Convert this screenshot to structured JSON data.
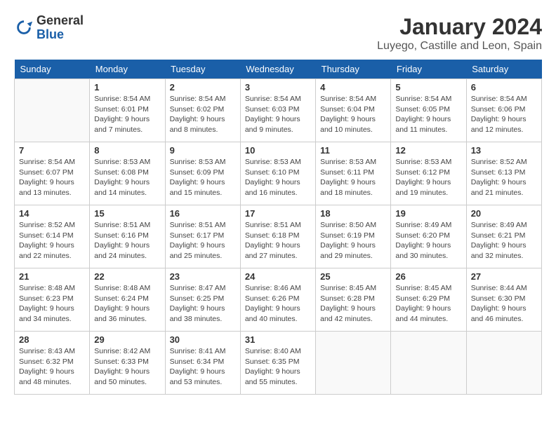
{
  "header": {
    "logo_general": "General",
    "logo_blue": "Blue",
    "title": "January 2024",
    "subtitle": "Luyego, Castille and Leon, Spain"
  },
  "days_of_week": [
    "Sunday",
    "Monday",
    "Tuesday",
    "Wednesday",
    "Thursday",
    "Friday",
    "Saturday"
  ],
  "weeks": [
    [
      {
        "day": "",
        "info": ""
      },
      {
        "day": "1",
        "info": "Sunrise: 8:54 AM\nSunset: 6:01 PM\nDaylight: 9 hours\nand 7 minutes."
      },
      {
        "day": "2",
        "info": "Sunrise: 8:54 AM\nSunset: 6:02 PM\nDaylight: 9 hours\nand 8 minutes."
      },
      {
        "day": "3",
        "info": "Sunrise: 8:54 AM\nSunset: 6:03 PM\nDaylight: 9 hours\nand 9 minutes."
      },
      {
        "day": "4",
        "info": "Sunrise: 8:54 AM\nSunset: 6:04 PM\nDaylight: 9 hours\nand 10 minutes."
      },
      {
        "day": "5",
        "info": "Sunrise: 8:54 AM\nSunset: 6:05 PM\nDaylight: 9 hours\nand 11 minutes."
      },
      {
        "day": "6",
        "info": "Sunrise: 8:54 AM\nSunset: 6:06 PM\nDaylight: 9 hours\nand 12 minutes."
      }
    ],
    [
      {
        "day": "7",
        "info": "Sunrise: 8:54 AM\nSunset: 6:07 PM\nDaylight: 9 hours\nand 13 minutes."
      },
      {
        "day": "8",
        "info": "Sunrise: 8:53 AM\nSunset: 6:08 PM\nDaylight: 9 hours\nand 14 minutes."
      },
      {
        "day": "9",
        "info": "Sunrise: 8:53 AM\nSunset: 6:09 PM\nDaylight: 9 hours\nand 15 minutes."
      },
      {
        "day": "10",
        "info": "Sunrise: 8:53 AM\nSunset: 6:10 PM\nDaylight: 9 hours\nand 16 minutes."
      },
      {
        "day": "11",
        "info": "Sunrise: 8:53 AM\nSunset: 6:11 PM\nDaylight: 9 hours\nand 18 minutes."
      },
      {
        "day": "12",
        "info": "Sunrise: 8:53 AM\nSunset: 6:12 PM\nDaylight: 9 hours\nand 19 minutes."
      },
      {
        "day": "13",
        "info": "Sunrise: 8:52 AM\nSunset: 6:13 PM\nDaylight: 9 hours\nand 21 minutes."
      }
    ],
    [
      {
        "day": "14",
        "info": "Sunrise: 8:52 AM\nSunset: 6:14 PM\nDaylight: 9 hours\nand 22 minutes."
      },
      {
        "day": "15",
        "info": "Sunrise: 8:51 AM\nSunset: 6:16 PM\nDaylight: 9 hours\nand 24 minutes."
      },
      {
        "day": "16",
        "info": "Sunrise: 8:51 AM\nSunset: 6:17 PM\nDaylight: 9 hours\nand 25 minutes."
      },
      {
        "day": "17",
        "info": "Sunrise: 8:51 AM\nSunset: 6:18 PM\nDaylight: 9 hours\nand 27 minutes."
      },
      {
        "day": "18",
        "info": "Sunrise: 8:50 AM\nSunset: 6:19 PM\nDaylight: 9 hours\nand 29 minutes."
      },
      {
        "day": "19",
        "info": "Sunrise: 8:49 AM\nSunset: 6:20 PM\nDaylight: 9 hours\nand 30 minutes."
      },
      {
        "day": "20",
        "info": "Sunrise: 8:49 AM\nSunset: 6:21 PM\nDaylight: 9 hours\nand 32 minutes."
      }
    ],
    [
      {
        "day": "21",
        "info": "Sunrise: 8:48 AM\nSunset: 6:23 PM\nDaylight: 9 hours\nand 34 minutes."
      },
      {
        "day": "22",
        "info": "Sunrise: 8:48 AM\nSunset: 6:24 PM\nDaylight: 9 hours\nand 36 minutes."
      },
      {
        "day": "23",
        "info": "Sunrise: 8:47 AM\nSunset: 6:25 PM\nDaylight: 9 hours\nand 38 minutes."
      },
      {
        "day": "24",
        "info": "Sunrise: 8:46 AM\nSunset: 6:26 PM\nDaylight: 9 hours\nand 40 minutes."
      },
      {
        "day": "25",
        "info": "Sunrise: 8:45 AM\nSunset: 6:28 PM\nDaylight: 9 hours\nand 42 minutes."
      },
      {
        "day": "26",
        "info": "Sunrise: 8:45 AM\nSunset: 6:29 PM\nDaylight: 9 hours\nand 44 minutes."
      },
      {
        "day": "27",
        "info": "Sunrise: 8:44 AM\nSunset: 6:30 PM\nDaylight: 9 hours\nand 46 minutes."
      }
    ],
    [
      {
        "day": "28",
        "info": "Sunrise: 8:43 AM\nSunset: 6:32 PM\nDaylight: 9 hours\nand 48 minutes."
      },
      {
        "day": "29",
        "info": "Sunrise: 8:42 AM\nSunset: 6:33 PM\nDaylight: 9 hours\nand 50 minutes."
      },
      {
        "day": "30",
        "info": "Sunrise: 8:41 AM\nSunset: 6:34 PM\nDaylight: 9 hours\nand 53 minutes."
      },
      {
        "day": "31",
        "info": "Sunrise: 8:40 AM\nSunset: 6:35 PM\nDaylight: 9 hours\nand 55 minutes."
      },
      {
        "day": "",
        "info": ""
      },
      {
        "day": "",
        "info": ""
      },
      {
        "day": "",
        "info": ""
      }
    ]
  ]
}
